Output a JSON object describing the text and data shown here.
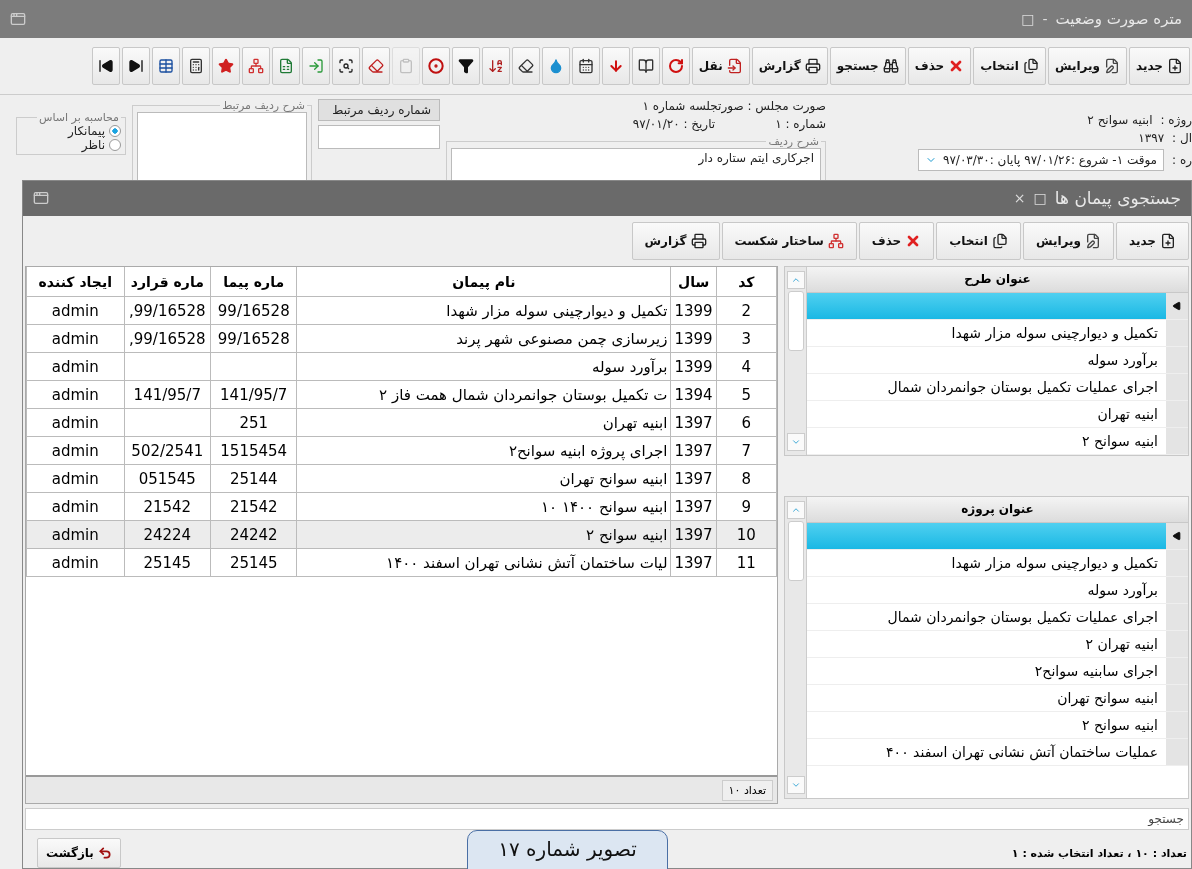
{
  "window": {
    "title": "متره صورت وضعیت",
    "controls": [
      "-",
      "□"
    ]
  },
  "toolbar": {
    "buttons": [
      {
        "kind": "new",
        "label": "جدید"
      },
      {
        "kind": "edit",
        "label": "ویرایش"
      },
      {
        "kind": "select",
        "label": "انتخاب"
      },
      {
        "kind": "delete",
        "label": "حذف"
      },
      {
        "kind": "search",
        "label": "جستجو"
      },
      {
        "kind": "report",
        "label": "گزارش"
      },
      {
        "kind": "move",
        "label": "نقل"
      }
    ],
    "icon_buttons": [
      {
        "kind": "refresh",
        "disabled": false
      },
      {
        "kind": "book",
        "disabled": false
      },
      {
        "kind": "arrow-down",
        "disabled": false
      },
      {
        "kind": "calendar",
        "disabled": false
      },
      {
        "kind": "drop",
        "disabled": false
      },
      {
        "kind": "eraser",
        "disabled": false
      },
      {
        "kind": "sort",
        "disabled": false
      },
      {
        "kind": "filter",
        "disabled": false
      },
      {
        "kind": "target",
        "disabled": false
      },
      {
        "kind": "clipboard",
        "disabled": true
      },
      {
        "kind": "eraser-red",
        "disabled": false
      },
      {
        "kind": "find",
        "disabled": false
      },
      {
        "kind": "import",
        "disabled": false
      },
      {
        "kind": "excel",
        "disabled": false
      },
      {
        "kind": "hierarchy",
        "disabled": false
      },
      {
        "kind": "star",
        "disabled": false
      },
      {
        "kind": "calculator",
        "disabled": false
      },
      {
        "kind": "table",
        "disabled": false
      },
      {
        "kind": "last",
        "disabled": false
      },
      {
        "kind": "first",
        "disabled": false
      }
    ]
  },
  "form": {
    "project_label": "روژه :",
    "project_value": "ابنیه سوانح ۲",
    "year_label": "ال :",
    "year_value": "۱۳۹۷",
    "period_label": "ره :",
    "period_value": "موقت ۱- شروع :۹۷/۰۱/۲۶ پایان :۹۷/۰۳/۳۰",
    "minutes": "صورت مجلس : صورتجلسه شماره ۱",
    "number": "شماره : ۱",
    "date": "تاریخ :  ۹۷/۰۱/۲۰",
    "row_desc_legend": "شرح ردیف",
    "row_desc": "اجرکاری ایتم ستاره دار",
    "related_grid_header": "شماره ردیف مرتبط",
    "related_desc_legend": "شرح ردیف مرتبط",
    "calc_legend": "محاسبه بر اساس",
    "calc_options": [
      {
        "label": "پیمانکار",
        "selected": true
      },
      {
        "label": "ناظر",
        "selected": false
      }
    ]
  },
  "dialog": {
    "title": "جستجوی پیمان ها",
    "controls": [
      "□",
      "×"
    ],
    "buttons": [
      {
        "kind": "new",
        "label": "جدید"
      },
      {
        "kind": "edit",
        "label": "ویرایش"
      },
      {
        "kind": "select",
        "label": "انتخاب"
      },
      {
        "kind": "delete",
        "label": "حذف"
      },
      {
        "kind": "structure",
        "label": "ساختار شکست"
      },
      {
        "kind": "report",
        "label": "گزارش"
      }
    ],
    "table": {
      "columns": [
        "کد",
        "سال",
        "نام پیمان",
        "ماره پیما",
        "ماره قرارد",
        "ایجاد کننده"
      ],
      "rows": [
        {
          "code": "2",
          "year": "1399",
          "name": "تکمیل و دیوارچینی سوله مزار شهدا",
          "contract_no": "99/16528",
          "agreement_no": "99/16528,",
          "creator": "admin",
          "selected": false
        },
        {
          "code": "3",
          "year": "1399",
          "name": "زیرسازی چمن مصنوعی شهر پرند",
          "contract_no": "99/16528",
          "agreement_no": "99/16528,",
          "creator": "admin",
          "selected": false
        },
        {
          "code": "4",
          "year": "1399",
          "name": "برآورد سوله",
          "creator": "admin",
          "selected": false
        },
        {
          "code": "5",
          "year": "1394",
          "name": "ت  تکمیل بوستان جوانمردان  شمال همت فاز ۲",
          "contract_no": "141/95/7",
          "agreement_no": "141/95/7",
          "creator": "admin",
          "selected": false
        },
        {
          "code": "6",
          "year": "1397",
          "name": "ابنیه تهران",
          "contract_no": "251",
          "creator": "admin",
          "selected": false
        },
        {
          "code": "7",
          "year": "1397",
          "name": "اجرای پروژه ابنیه سوانح۲",
          "contract_no": "1515454",
          "agreement_no": "502/2541",
          "creator": "admin",
          "selected": false
        },
        {
          "code": "8",
          "year": "1397",
          "name": "ابنیه سوانح تهران",
          "contract_no": "25144",
          "agreement_no": "051545",
          "creator": "admin",
          "selected": false
        },
        {
          "code": "9",
          "year": "1397",
          "name": "ابنیه سوانح  ۱۴۰۰ ۱۰",
          "contract_no": "21542",
          "agreement_no": "21542",
          "creator": "admin",
          "selected": false
        },
        {
          "code": "10",
          "year": "1397",
          "name": "ابنیه سوانح ۲",
          "contract_no": "24242",
          "agreement_no": "24224",
          "creator": "admin",
          "selected": true
        },
        {
          "code": "11",
          "year": "1397",
          "name": "لیات ساختمان آتش نشانی  تهران اسفند ۱۴۰۰",
          "contract_no": "25145",
          "agreement_no": "25145",
          "creator": "admin",
          "selected": false
        }
      ],
      "footer": "تعداد ۱۰"
    },
    "lists": [
      {
        "header": "عنوان طرح",
        "items": [
          {
            "selected": true
          },
          {
            "label": "تکمیل و دیوارچینی سوله مزار شهدا",
            "selected": false
          },
          {
            "label": "برآورد سوله",
            "selected": false
          },
          {
            "label": "اجرای عملیات  تکمیل بوستان جوانمردان  شمال",
            "selected": false
          },
          {
            "label": "ابنیه تهران",
            "selected": false
          },
          {
            "label": "ابنیه سوانح ۲",
            "selected": false
          }
        ]
      },
      {
        "header": "عنوان پروژه",
        "items": [
          {
            "selected": true
          },
          {
            "label": "تکمیل و دیوارچینی سوله مزار شهدا",
            "selected": false
          },
          {
            "label": "برآورد سوله",
            "selected": false
          },
          {
            "label": "اجرای عملیات  تکمیل بوستان جوانمردان  شمال",
            "selected": false
          },
          {
            "label": "ابنیه تهران ۲",
            "selected": false
          },
          {
            "label": "اجرای سابنیه سوانح۲",
            "selected": false
          },
          {
            "label": "ابنیه سوانح تهران",
            "selected": false
          },
          {
            "label": "ابنیه سوانح ۲",
            "selected": false
          },
          {
            "label": "عملیات ساختمان آتش نشانی  تهران اسفند ۴۰۰",
            "selected": false
          }
        ]
      }
    ],
    "search": {
      "placeholder": "جستجو"
    },
    "back_button": "بازگشت",
    "status": "تعداد : ۱۰ ، تعداد انتخاب شده : ۱"
  },
  "caption": "تصویر شماره ۱۷"
}
